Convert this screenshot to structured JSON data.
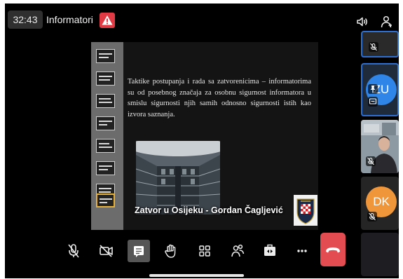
{
  "header": {
    "timer": "32:43",
    "meeting_title": "Informatori",
    "alert_icon": "warning-triangle-icon"
  },
  "presentation": {
    "slide_text": "Taktike postupanja i rada sa zatvorenicima – informatorima su od posebnog značaja za osobnu sigurnost informatora u smislu sigurnosti njih samih odnosno sigurnosti istih kao izvora saznanja.",
    "caption": "Zatvor u Osijeku - Gordan Čagljević",
    "thumbnail_count": 8,
    "selected_thumbnail": 8
  },
  "participants": [
    {
      "initials": "",
      "muted": true
    },
    {
      "initials": "ZU",
      "muted": false,
      "pinned": true
    },
    {
      "initials": "",
      "muted": true,
      "video": true
    },
    {
      "initials": "DK",
      "muted": true
    },
    {
      "initials": ""
    }
  ],
  "controls": [
    "mic-off-icon",
    "camera-off-icon",
    "chat-icon",
    "raise-hand-icon",
    "gallery-icon",
    "participants-icon",
    "share-icon",
    "more-icon",
    "end-call-icon"
  ],
  "colors": {
    "background": "#000000",
    "alert": "#e03b44",
    "end_call": "#e34d52",
    "highlight": "#2c6fd1",
    "avatar_zu": "#2f86e8",
    "avatar_dk": "#f0963a"
  }
}
